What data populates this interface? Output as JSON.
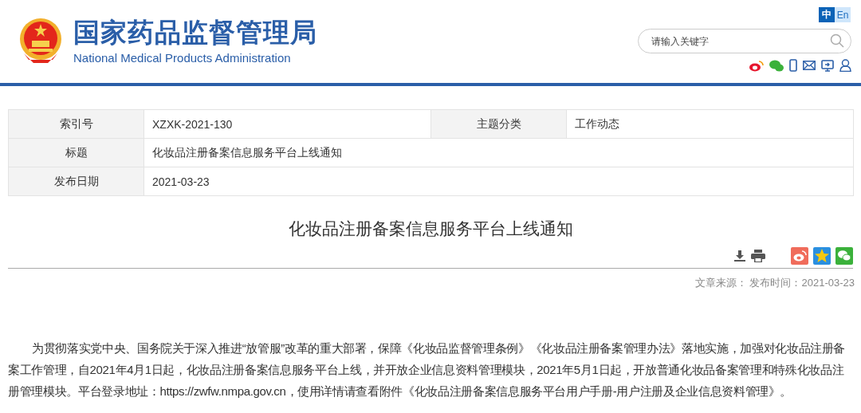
{
  "header": {
    "title": "国家药品监督管理局",
    "subtitle": "National Medical Products Administration",
    "languages": [
      {
        "label": "中",
        "selected": true
      },
      {
        "label": "En",
        "selected": false
      }
    ],
    "search": {
      "placeholder": "请输入关键字"
    }
  },
  "info_rows": [
    [
      {
        "label": "索引号",
        "value": "XZXK-2021-130"
      },
      {
        "label": "主题分类",
        "value": "工作动态"
      }
    ],
    [
      {
        "label": "标题",
        "value": "化妆品注册备案信息服务平台上线通知"
      }
    ],
    [
      {
        "label": "发布日期",
        "value": "2021-03-23"
      }
    ]
  ],
  "article": {
    "title": "化妆品注册备案信息服务平台上线通知",
    "meta": "文章来源： 发布时间：2021-03-23",
    "body": "为贯彻落实党中央、国务院关于深入推进“放管服”改革的重大部署，保障《化妆品监督管理条例》《化妆品注册备案管理办法》落地实施，加强对化妆品注册备案工作管理，自2021年4月1日起，化妆品注册备案信息服务平台上线，并开放企业信息资料管理模块，2021年5月1日起，开放普通化妆品备案管理和特殊化妆品注册管理模块。平台登录地址：https://zwfw.nmpa.gov.cn，使用详情请查看附件《化妆品注册备案信息服务平台用户手册-用户注册及企业信息资料管理》。"
  }
}
